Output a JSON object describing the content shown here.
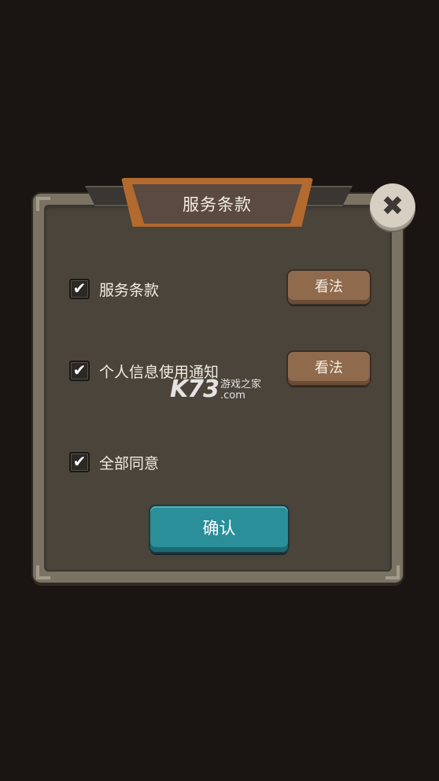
{
  "dialog": {
    "title": "服务条款",
    "close_icon": "close-icon",
    "rows": [
      {
        "label": "服务条款",
        "checked": true,
        "button_label": "看法"
      },
      {
        "label": "个人信息使用通知",
        "checked": true,
        "button_label": "看法"
      },
      {
        "label": "全部同意",
        "checked": true
      }
    ],
    "checkmark": "✔",
    "close_glyph": "✖",
    "confirm_label": "确认"
  },
  "watermark": {
    "logo": "K73",
    "tagline": "游戏之家",
    "domain": ".com"
  },
  "colors": {
    "background": "#1a1512",
    "panel_border": "#7a7363",
    "panel_inner": "#4a443b",
    "title_frame": "#b26a2e",
    "view_button": "#8f6a4d",
    "confirm_button": "#2a8f99"
  }
}
